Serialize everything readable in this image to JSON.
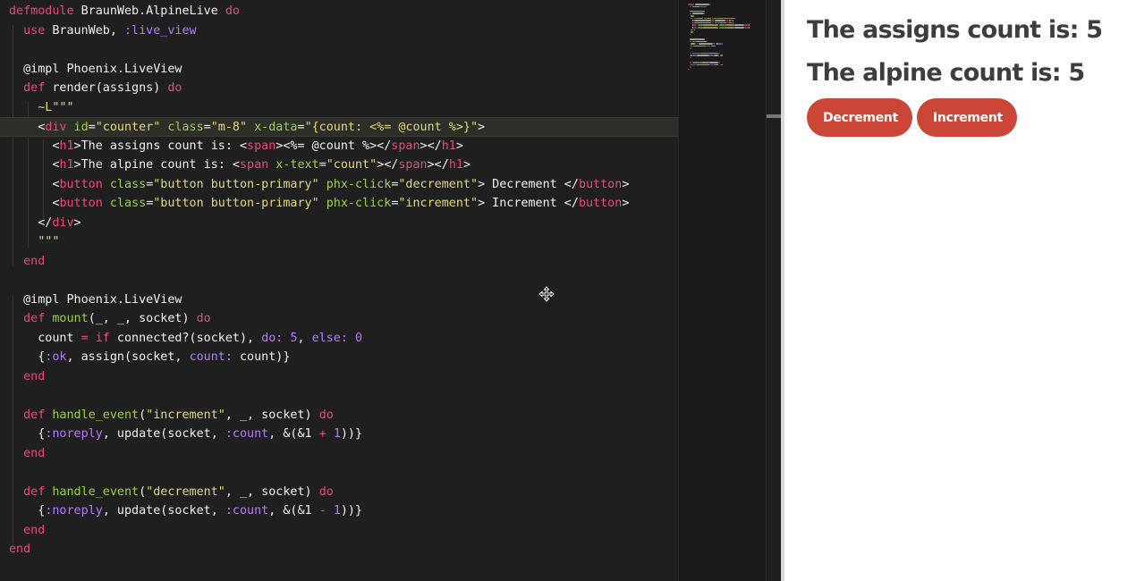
{
  "editor": {
    "lines": [
      [
        [
          "defmodule",
          "#e24d79"
        ],
        [
          " BraunWeb.AlpineLive ",
          "#f1f1ee"
        ],
        [
          "do",
          "#e24d79"
        ]
      ],
      [
        [
          "  use",
          "#e24d79"
        ],
        [
          " BraunWeb, ",
          "#f1f1ee"
        ],
        [
          ":live_view",
          "#b57bf7"
        ]
      ],
      [],
      [
        [
          "  @impl Phoenix.LiveView",
          "#f1f1ee"
        ]
      ],
      [
        [
          "  def",
          "#e24d79"
        ],
        [
          " render(assigns) ",
          "#f1f1ee"
        ],
        [
          "do",
          "#e24d79"
        ]
      ],
      [
        [
          "    ~L\"\"\"",
          "#e3d979"
        ]
      ],
      [
        [
          "    <",
          "#f1f1ee"
        ],
        [
          "div",
          "#e24d79"
        ],
        [
          " id",
          "#9ad148"
        ],
        [
          "=",
          "#f1f1ee"
        ],
        [
          "\"counter\"",
          "#e3d979"
        ],
        [
          " class",
          "#9ad148"
        ],
        [
          "=",
          "#f1f1ee"
        ],
        [
          "\"m-8\"",
          "#e3d979"
        ],
        [
          " x-data",
          "#9ad148"
        ],
        [
          "=",
          "#f1f1ee"
        ],
        [
          "\"{count: <%= @count %>}\"",
          "#e3d979"
        ],
        [
          ">",
          "#f1f1ee"
        ]
      ],
      [
        [
          "      <",
          "#f1f1ee"
        ],
        [
          "h1",
          "#e24d79"
        ],
        [
          ">The assigns count is: <",
          "#f1f1ee"
        ],
        [
          "span",
          "#e24d79"
        ],
        [
          "><%= @count %></",
          "#f1f1ee"
        ],
        [
          "span",
          "#e24d79"
        ],
        [
          "></",
          "#f1f1ee"
        ],
        [
          "h1",
          "#e24d79"
        ],
        [
          ">",
          "#f1f1ee"
        ]
      ],
      [
        [
          "      <",
          "#f1f1ee"
        ],
        [
          "h1",
          "#e24d79"
        ],
        [
          ">The alpine count is: <",
          "#f1f1ee"
        ],
        [
          "span",
          "#e24d79"
        ],
        [
          " x-text",
          "#9ad148"
        ],
        [
          "=",
          "#f1f1ee"
        ],
        [
          "\"count\"",
          "#e3d979"
        ],
        [
          "></",
          "#f1f1ee"
        ],
        [
          "span",
          "#e24d79"
        ],
        [
          "></",
          "#f1f1ee"
        ],
        [
          "h1",
          "#e24d79"
        ],
        [
          ">",
          "#f1f1ee"
        ]
      ],
      [
        [
          "      <",
          "#f1f1ee"
        ],
        [
          "button",
          "#e24d79"
        ],
        [
          " class",
          "#9ad148"
        ],
        [
          "=",
          "#f1f1ee"
        ],
        [
          "\"button button-primary\"",
          "#e3d979"
        ],
        [
          " phx-click",
          "#9ad148"
        ],
        [
          "=",
          "#f1f1ee"
        ],
        [
          "\"decrement\"",
          "#e3d979"
        ],
        [
          "> Decrement </",
          "#f1f1ee"
        ],
        [
          "button",
          "#e24d79"
        ],
        [
          ">",
          "#f1f1ee"
        ]
      ],
      [
        [
          "      <",
          "#f1f1ee"
        ],
        [
          "button",
          "#e24d79"
        ],
        [
          " class",
          "#9ad148"
        ],
        [
          "=",
          "#f1f1ee"
        ],
        [
          "\"button button-primary\"",
          "#e3d979"
        ],
        [
          " phx-click",
          "#9ad148"
        ],
        [
          "=",
          "#f1f1ee"
        ],
        [
          "\"increment\"",
          "#e3d979"
        ],
        [
          "> Increment </",
          "#f1f1ee"
        ],
        [
          "button",
          "#e24d79"
        ],
        [
          ">",
          "#f1f1ee"
        ]
      ],
      [
        [
          "    </",
          "#f1f1ee"
        ],
        [
          "div",
          "#e24d79"
        ],
        [
          ">",
          "#f1f1ee"
        ]
      ],
      [
        [
          "    \"\"\"",
          "#e3d979"
        ]
      ],
      [
        [
          "  end",
          "#e24d79"
        ]
      ],
      [],
      [
        [
          "  @impl Phoenix.LiveView",
          "#f1f1ee"
        ]
      ],
      [
        [
          "  def",
          "#e24d79"
        ],
        [
          " mount",
          "#9ad148"
        ],
        [
          "(_, _, socket) ",
          "#f1f1ee"
        ],
        [
          "do",
          "#e24d79"
        ]
      ],
      [
        [
          "    count ",
          "#f1f1ee"
        ],
        [
          "=",
          "#e24d79"
        ],
        [
          " ",
          "#f1f1ee"
        ],
        [
          "if",
          "#e24d79"
        ],
        [
          " connected?(socket), ",
          "#f1f1ee"
        ],
        [
          "do:",
          "#b57bf7"
        ],
        [
          " ",
          "#f1f1ee"
        ],
        [
          "5",
          "#b57bf7"
        ],
        [
          ", ",
          "#f1f1ee"
        ],
        [
          "else:",
          "#b57bf7"
        ],
        [
          " ",
          "#f1f1ee"
        ],
        [
          "0",
          "#b57bf7"
        ]
      ],
      [
        [
          "    {",
          "#f1f1ee"
        ],
        [
          ":ok",
          "#b57bf7"
        ],
        [
          ", assign(socket, ",
          "#f1f1ee"
        ],
        [
          "count:",
          "#b57bf7"
        ],
        [
          " count)}",
          "#f1f1ee"
        ]
      ],
      [
        [
          "  end",
          "#e24d79"
        ]
      ],
      [],
      [
        [
          "  def",
          "#e24d79"
        ],
        [
          " handle_event",
          "#9ad148"
        ],
        [
          "(",
          "#f1f1ee"
        ],
        [
          "\"increment\"",
          "#e3d979"
        ],
        [
          ", _, socket) ",
          "#f1f1ee"
        ],
        [
          "do",
          "#e24d79"
        ]
      ],
      [
        [
          "    {",
          "#f1f1ee"
        ],
        [
          ":noreply",
          "#b57bf7"
        ],
        [
          ", update(socket, ",
          "#f1f1ee"
        ],
        [
          ":count",
          "#b57bf7"
        ],
        [
          ", &(&1 ",
          "#f1f1ee"
        ],
        [
          "+",
          "#e24d79"
        ],
        [
          " ",
          "#f1f1ee"
        ],
        [
          "1",
          "#b57bf7"
        ],
        [
          "))}",
          "#f1f1ee"
        ]
      ],
      [
        [
          "  end",
          "#e24d79"
        ]
      ],
      [],
      [
        [
          "  def",
          "#e24d79"
        ],
        [
          " handle_event",
          "#9ad148"
        ],
        [
          "(",
          "#f1f1ee"
        ],
        [
          "\"decrement\"",
          "#e3d979"
        ],
        [
          ", _, socket) ",
          "#f1f1ee"
        ],
        [
          "do",
          "#e24d79"
        ]
      ],
      [
        [
          "    {",
          "#f1f1ee"
        ],
        [
          ":noreply",
          "#b57bf7"
        ],
        [
          ", update(socket, ",
          "#f1f1ee"
        ],
        [
          ":count",
          "#b57bf7"
        ],
        [
          ", &(&1 ",
          "#f1f1ee"
        ],
        [
          "-",
          "#e24d79"
        ],
        [
          " ",
          "#f1f1ee"
        ],
        [
          "1",
          "#b57bf7"
        ],
        [
          "))}",
          "#f1f1ee"
        ]
      ],
      [
        [
          "  end",
          "#e24d79"
        ]
      ],
      [
        [
          "end",
          "#e24d79"
        ]
      ]
    ],
    "highlighted_line": 6
  },
  "preview": {
    "assigns_heading": "The assigns count is: 5",
    "alpine_heading": "The alpine count is: 5",
    "decrement_label": "Decrement",
    "increment_label": "Increment",
    "button_color": "#cc4637"
  },
  "cursor_icon": "move-cursor-icon"
}
